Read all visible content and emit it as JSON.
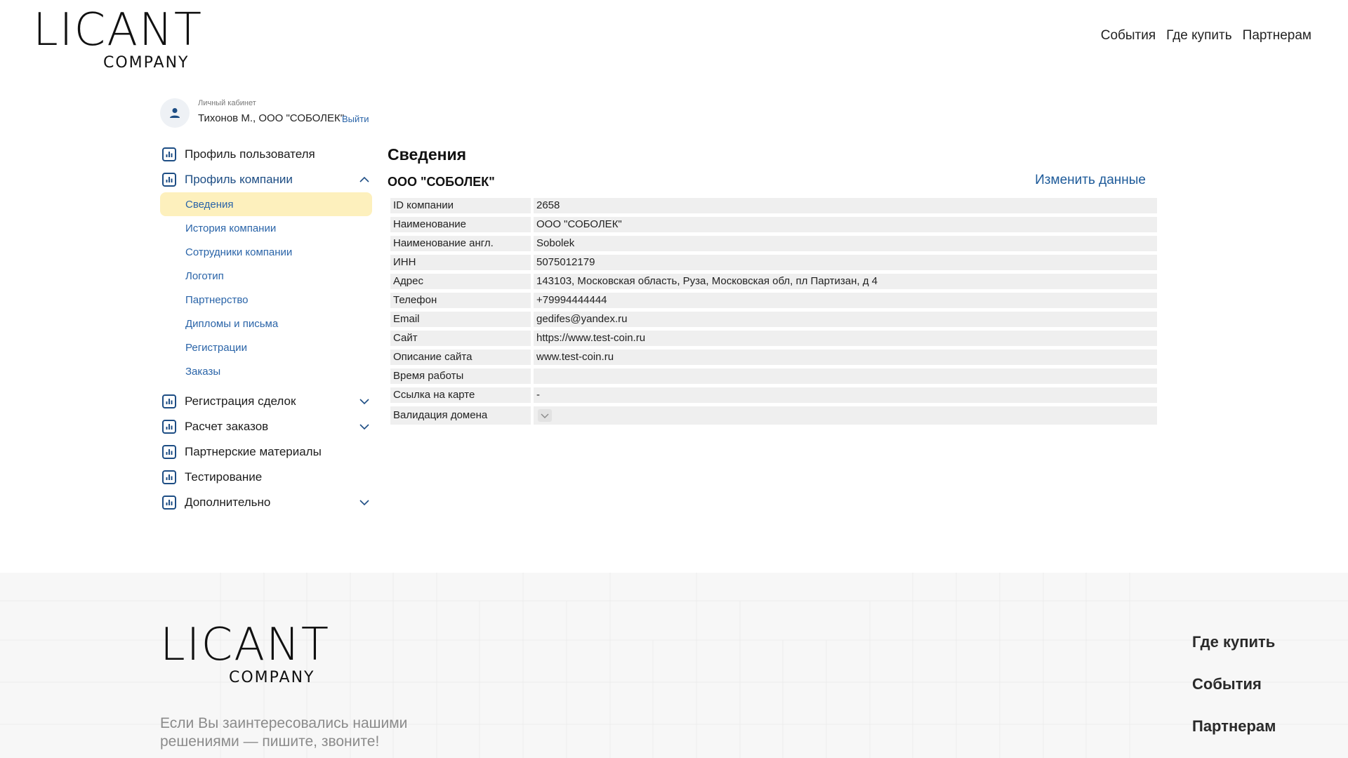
{
  "header": {
    "logo": {
      "main": "LICANT",
      "sub": "COMPANY"
    },
    "nav": [
      {
        "label": "События"
      },
      {
        "label": "Где купить"
      },
      {
        "label": "Партнерам"
      }
    ]
  },
  "account": {
    "caption": "Личный кабинет",
    "user": "Тихонов М., ООО \"СОБОЛЕК\"",
    "logout": "Выйти"
  },
  "sidebar": {
    "items": [
      {
        "label": "Профиль пользователя"
      },
      {
        "label": "Профиль компании"
      },
      {
        "label": "Регистрация сделок"
      },
      {
        "label": "Расчет заказов"
      },
      {
        "label": "Партнерские материалы"
      },
      {
        "label": "Тестирование"
      },
      {
        "label": "Дополнительно"
      }
    ],
    "company_submenu": [
      {
        "label": "Сведения"
      },
      {
        "label": "История компании"
      },
      {
        "label": "Сотрудники компании"
      },
      {
        "label": "Логотип"
      },
      {
        "label": "Партнерство"
      },
      {
        "label": "Дипломы и письма"
      },
      {
        "label": "Регистрации"
      },
      {
        "label": "Заказы"
      }
    ]
  },
  "content": {
    "title": "Сведения",
    "company_name": "ООО \"СОБОЛЕК\"",
    "edit_label": "Изменить данные",
    "rows": [
      {
        "label": "ID компании",
        "value": "2658"
      },
      {
        "label": "Наименование",
        "value": "ООО \"СОБОЛЕК\""
      },
      {
        "label": "Наименование англ.",
        "value": "Sobolek"
      },
      {
        "label": "ИНН",
        "value": "5075012179"
      },
      {
        "label": "Адрес",
        "value": "143103, Московская область, Руза, Московская обл, пл Партизан, д 4"
      },
      {
        "label": "Телефон",
        "value": "+79994444444"
      },
      {
        "label": "Email",
        "value": "gedifes@yandex.ru"
      },
      {
        "label": "Сайт",
        "value": "https://www.test-coin.ru"
      },
      {
        "label": "Описание сайта",
        "value": "www.test-coin.ru"
      },
      {
        "label": "Время работы",
        "value": ""
      },
      {
        "label": "Ссылка на карте",
        "value": "-"
      },
      {
        "label": "Валидация домена",
        "value": ""
      }
    ]
  },
  "footer": {
    "logo": {
      "main": "LICANT",
      "sub": "COMPANY"
    },
    "text": "Если Вы заинтересовались нашими решениями — пишите, звоните!",
    "nav": [
      {
        "label": "Где купить"
      },
      {
        "label": "События"
      },
      {
        "label": "Партнерам"
      }
    ]
  },
  "colors": {
    "accent_link": "#2a64a8",
    "active_submenu_bg": "#fdf0bd",
    "table_cell_bg": "#efefef",
    "footer_bg": "#f7f7f7"
  }
}
